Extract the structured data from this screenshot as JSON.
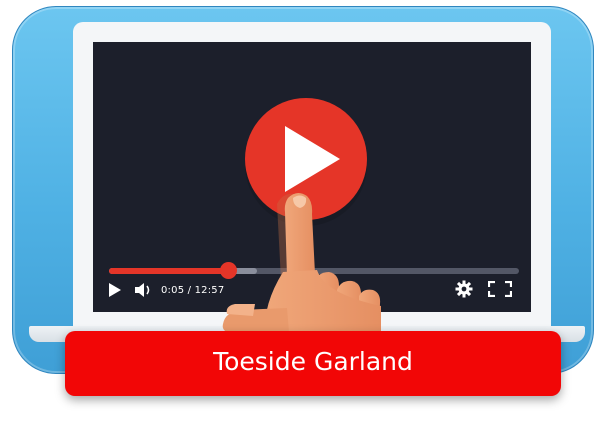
{
  "player": {
    "time_label": "0:05 / 12:57",
    "progress": 0.29,
    "buffered": 0.36,
    "accent_color": "#e53528",
    "icons": [
      "play-icon",
      "volume-icon",
      "settings-gear-icon",
      "fullscreen-icon"
    ]
  },
  "caption": {
    "text": "Toeside Garland",
    "color": "#f20606"
  }
}
